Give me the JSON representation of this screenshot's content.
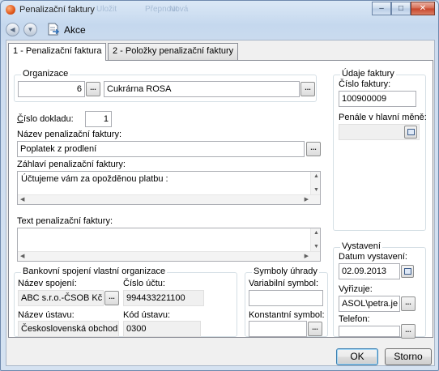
{
  "window": {
    "title": "Penalizační faktury",
    "ghost_labels": [
      "Uložit",
      "Přepnout",
      "Nová"
    ],
    "caption_buttons": {
      "minimize": "–",
      "maximize": "□",
      "close": "✕"
    }
  },
  "toolbar": {
    "back_icon": "back-icon",
    "forward_icon": "forward-icon",
    "akce_icon": "document-arrow-icon",
    "akce_label": "Akce"
  },
  "tabs": [
    {
      "label": "1 - Penalizační faktura",
      "active": true
    },
    {
      "label": "2 - Položky penalizační faktury",
      "active": false
    }
  ],
  "organizace": {
    "title": "Organizace",
    "number": "6",
    "name": "Cukrárna ROSA"
  },
  "doklad": {
    "label": "Číslo dokladu:",
    "value": "1"
  },
  "nazev": {
    "label": "Název penalizační faktury:",
    "value": "Poplatek z prodlení"
  },
  "zahlavi": {
    "label": "Záhlaví penalizační faktury:",
    "value": "Účtujeme vám za opožděnou platbu :"
  },
  "text": {
    "label": "Text penalizační faktury:",
    "value": ""
  },
  "udaje": {
    "title": "Údaje faktury",
    "cislo_label": "Číslo faktury:",
    "cislo_value": "100900009",
    "penale_label": "Penále v hlavní měně:",
    "penale_value": ""
  },
  "bank": {
    "title": "Bankovní spojení vlastní organizace",
    "nazev_spojeni_label": "Název spojení:",
    "nazev_spojeni_value": "ABC s.r.o.-ČSOB Kč",
    "cislo_uctu_label": "Číslo účtu:",
    "cislo_uctu_value": "994433221100",
    "nazev_ustavu_label": "Název ústavu:",
    "nazev_ustavu_value": "Československá obchodní",
    "kod_ustavu_label": "Kód ústavu:",
    "kod_ustavu_value": "0300"
  },
  "symboly": {
    "title": "Symboly úhrady",
    "variabilni_label": "Variabilní symbol:",
    "variabilni_value": "",
    "konstantni_label": "Konstantní symbol:",
    "konstantni_value": ""
  },
  "vystaveni": {
    "title": "Vystavení",
    "datum_label": "Datum vystavení:",
    "datum_value": "02.09.2013",
    "vyrizuje_label": "Vyřizuje:",
    "vyrizuje_value": "ASOL\\petra.je",
    "telefon_label": "Telefon:",
    "telefon_value": ""
  },
  "buttons": {
    "ok": "OK",
    "cancel": "Storno",
    "dots": "..."
  },
  "colors": {
    "title_bar": "#c5d8ee",
    "close_button": "#c7442a",
    "panel": "#ffffff"
  }
}
